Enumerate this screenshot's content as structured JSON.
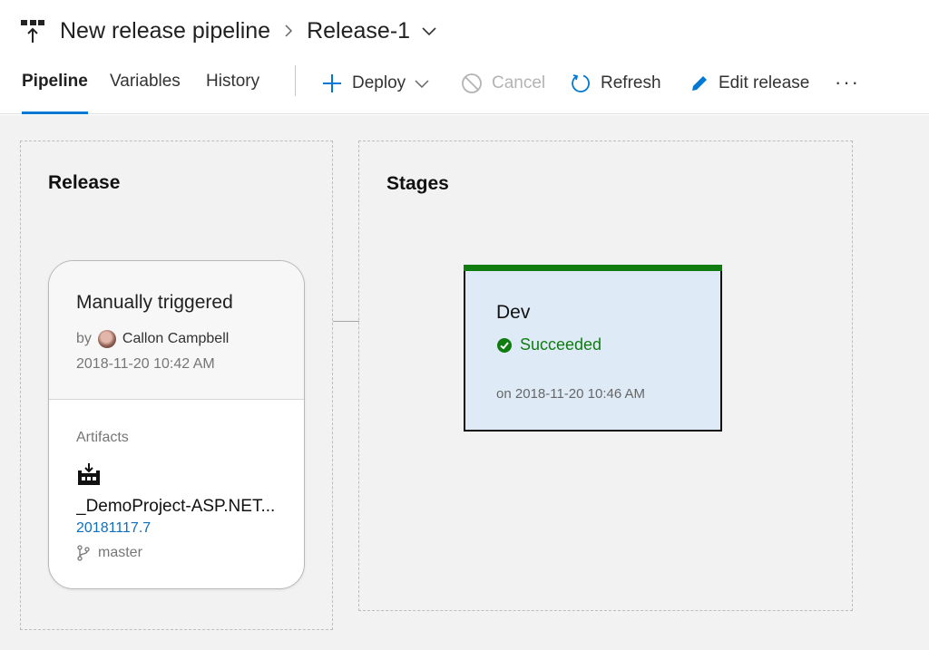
{
  "header": {
    "pipeline_name": "New release pipeline",
    "release_name": "Release-1"
  },
  "tabs": [
    {
      "label": "Pipeline",
      "active": true
    },
    {
      "label": "Variables",
      "active": false
    },
    {
      "label": "History",
      "active": false
    }
  ],
  "commands": {
    "deploy": "Deploy",
    "cancel": "Cancel",
    "refresh": "Refresh",
    "edit_release": "Edit release",
    "more": "···"
  },
  "release_panel": {
    "title": "Release",
    "trigger": "Manually triggered",
    "by_prefix": "by",
    "user": "Callon Campbell",
    "date": "2018-11-20 10:42 AM",
    "artifacts_label": "Artifacts",
    "artifact_name": "_DemoProject-ASP.NET...",
    "build_number": "20181117.7",
    "branch": "master"
  },
  "stages_panel": {
    "title": "Stages",
    "stage": {
      "name": "Dev",
      "status": "Succeeded",
      "date": "on 2018-11-20 10:46 AM"
    }
  },
  "colors": {
    "accent": "#0078d4",
    "success": "#107c10",
    "stage_bg": "#deebf7",
    "canvas_bg": "#f2f2f2"
  }
}
